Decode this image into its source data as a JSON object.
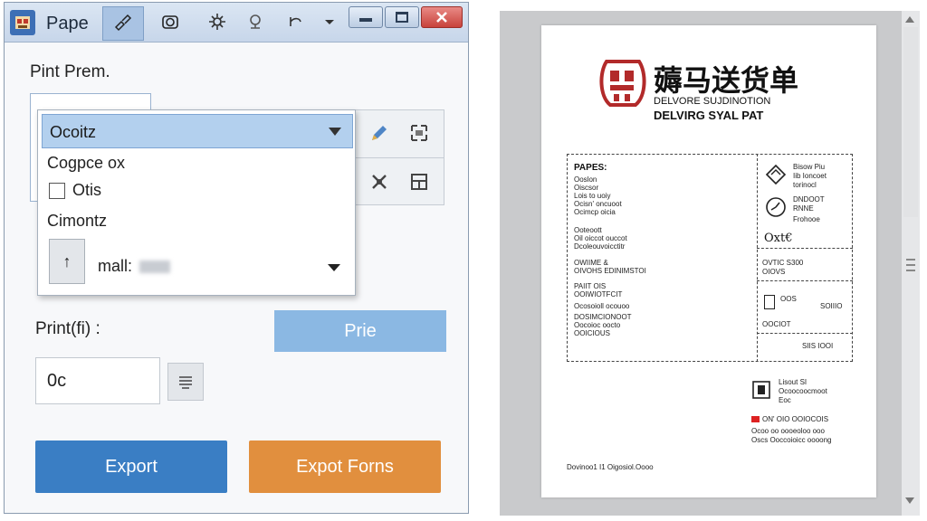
{
  "window": {
    "app_name": "Pape",
    "print_prem_label": "Pint Prem.",
    "dropdown": {
      "selected": "Ocoitz",
      "item1": "Cogpce ox",
      "checkbox_label": "Otis",
      "checkbox_checked": false,
      "item3": "Cimontz",
      "up_button": "↑",
      "mail_label": "mall:"
    },
    "print_fi_label": "Print(fi) :",
    "prie_button": "Prie",
    "quantity_value": "0c",
    "export_button": "Export",
    "export_forms_button": "Expot Forns",
    "colors": {
      "export": "#3a7ec4",
      "export_forms": "#e18f3e",
      "prie": "#8bb8e3",
      "selection": "#b3d0ee"
    }
  },
  "preview": {
    "title_cn": "薅马送货单",
    "subtitle1": "DELVORE SUJDINOTION",
    "subtitle2": "DELVIRG SYAL PAT",
    "left_col": {
      "heading": "PAPES:",
      "group1": [
        "Ooslon",
        "Oiscsor",
        "Lois to uoiy",
        "Ocisn' oncuoot",
        "Ocimcp oicia"
      ],
      "group2": [
        "Ooteoott",
        "Oil oiccot ouccot",
        "Dcoleouvoicctitr"
      ],
      "group3": [
        "OWIIME &",
        "OIVOHS EDINIMSTOI"
      ],
      "group4": [
        "PAIIT OIS",
        "OOIWIOTFCIT",
        "Ocosoioll ocouoo"
      ],
      "group5": [
        "DOSIMCIONOOT",
        "Oocoioc oocto",
        "OOICIOUS"
      ]
    },
    "right_col": {
      "block1": [
        "Bisow Piu",
        "Iib Ioncoet",
        "torinocl"
      ],
      "block2": [
        "DNDOOT",
        "RNNE",
        "Frohooe"
      ],
      "handwritten": "Oxt€",
      "block3": [
        "OVTIC S300",
        "OIOVS"
      ],
      "block4": [
        "OOS",
        "OOCIOT"
      ],
      "value1": "SOIIIO",
      "value2": "SIIS IOOI"
    },
    "footer_block": [
      "Lisout SI",
      "Ocoocoocmoot",
      "Eoc"
    ],
    "footer_red_line": "ON' OIO OOIOCOIS",
    "footer_line2": "Ocoo oo oooeoloo ooo",
    "footer_line3": "Oscs Ooccoioicc oooong",
    "bottom_note": "Dovinoo1 I1 Oigosiol.Oooo",
    "logo_color": "#b22a2a"
  }
}
